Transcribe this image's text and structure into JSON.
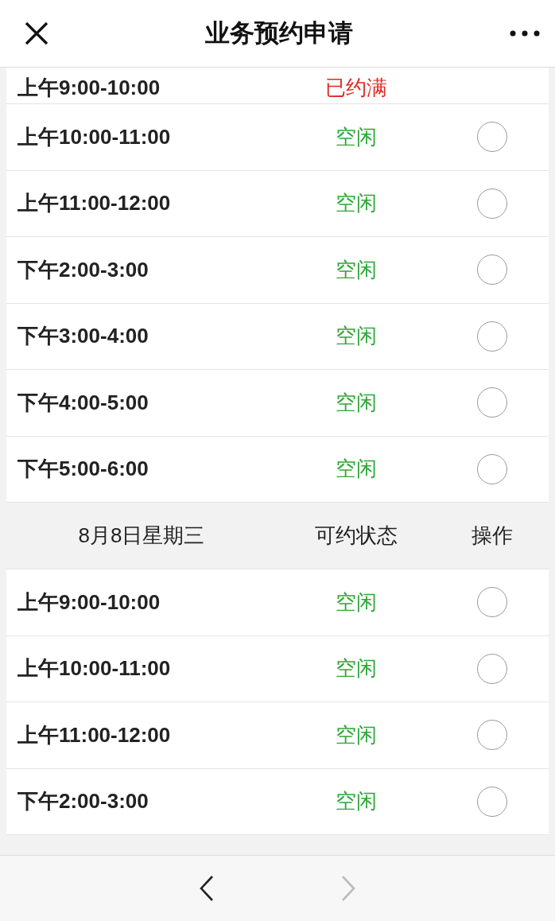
{
  "header": {
    "title": "业务预约申请"
  },
  "sections": [
    {
      "rows": [
        {
          "time": "上午9:00-10:00",
          "status": "已约满",
          "kind": "full"
        },
        {
          "time": "上午10:00-11:00",
          "status": "空闲",
          "kind": "free",
          "selected": false
        },
        {
          "time": "上午11:00-12:00",
          "status": "空闲",
          "kind": "free",
          "selected": false
        },
        {
          "time": "下午2:00-3:00",
          "status": "空闲",
          "kind": "free",
          "selected": false
        },
        {
          "time": "下午3:00-4:00",
          "status": "空闲",
          "kind": "free",
          "selected": false
        },
        {
          "time": "下午4:00-5:00",
          "status": "空闲",
          "kind": "free",
          "selected": false
        },
        {
          "time": "下午5:00-6:00",
          "status": "空闲",
          "kind": "free",
          "selected": false
        }
      ]
    },
    {
      "heading": {
        "date": "8月8日星期三",
        "status": "可约状态",
        "action": "操作"
      },
      "rows": [
        {
          "time": "上午9:00-10:00",
          "status": "空闲",
          "kind": "free",
          "selected": false
        },
        {
          "time": "上午10:00-11:00",
          "status": "空闲",
          "kind": "free",
          "selected": false
        },
        {
          "time": "上午11:00-12:00",
          "status": "空闲",
          "kind": "free",
          "selected": false
        },
        {
          "time": "下午2:00-3:00",
          "status": "空闲",
          "kind": "free",
          "selected": false
        }
      ]
    }
  ],
  "toolbar": {
    "back_disabled": false,
    "forward_disabled": true
  }
}
